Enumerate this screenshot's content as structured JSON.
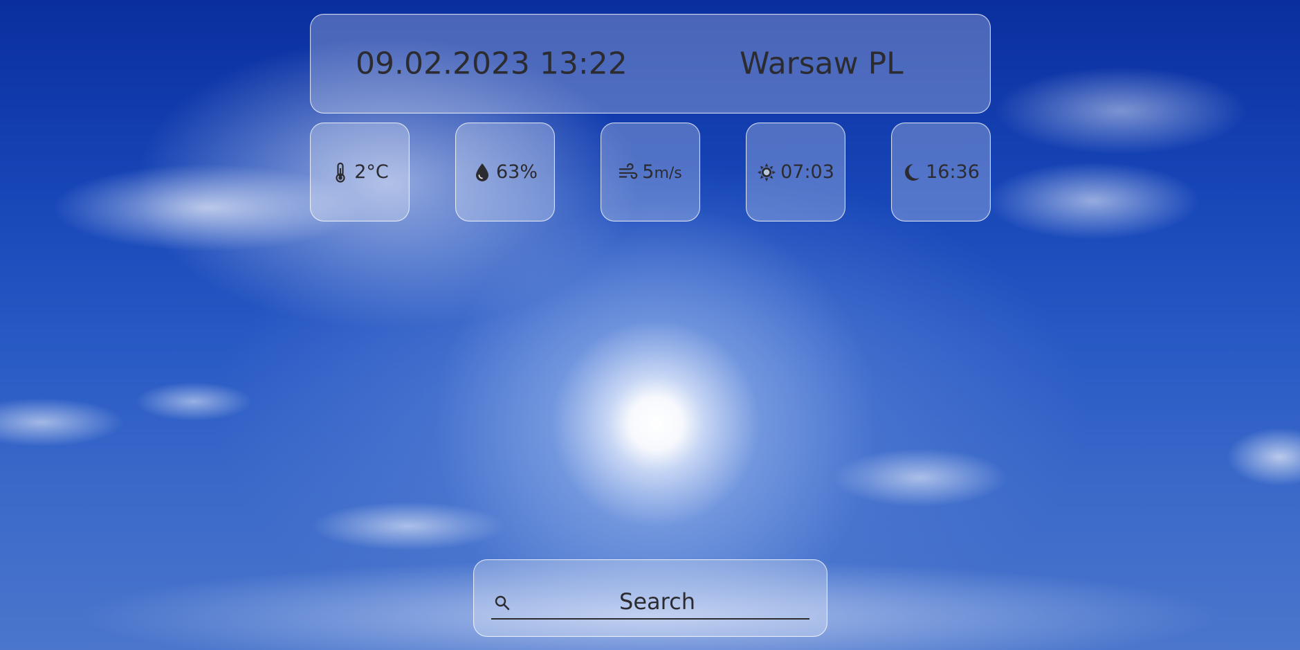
{
  "header": {
    "datetime": "09.02.2023 13:22",
    "location": "Warsaw PL"
  },
  "stats": [
    {
      "icon": "thermometer-icon",
      "value": "2°C"
    },
    {
      "icon": "droplet-icon",
      "value": "63%"
    },
    {
      "icon": "wind-icon",
      "value": "5",
      "unit": "m/s"
    },
    {
      "icon": "sunrise-icon",
      "value": "07:03"
    },
    {
      "icon": "moon-icon",
      "value": "16:36"
    }
  ],
  "search": {
    "placeholder": "Search",
    "icon": "search-icon"
  },
  "colors": {
    "text": "#2b2b30",
    "glass": "rgba(255,255,255,0.26)",
    "glass_border": "rgba(255,255,255,0.75)",
    "sky_top": "#0a2e9e",
    "sky_bottom": "#4b76cc"
  }
}
